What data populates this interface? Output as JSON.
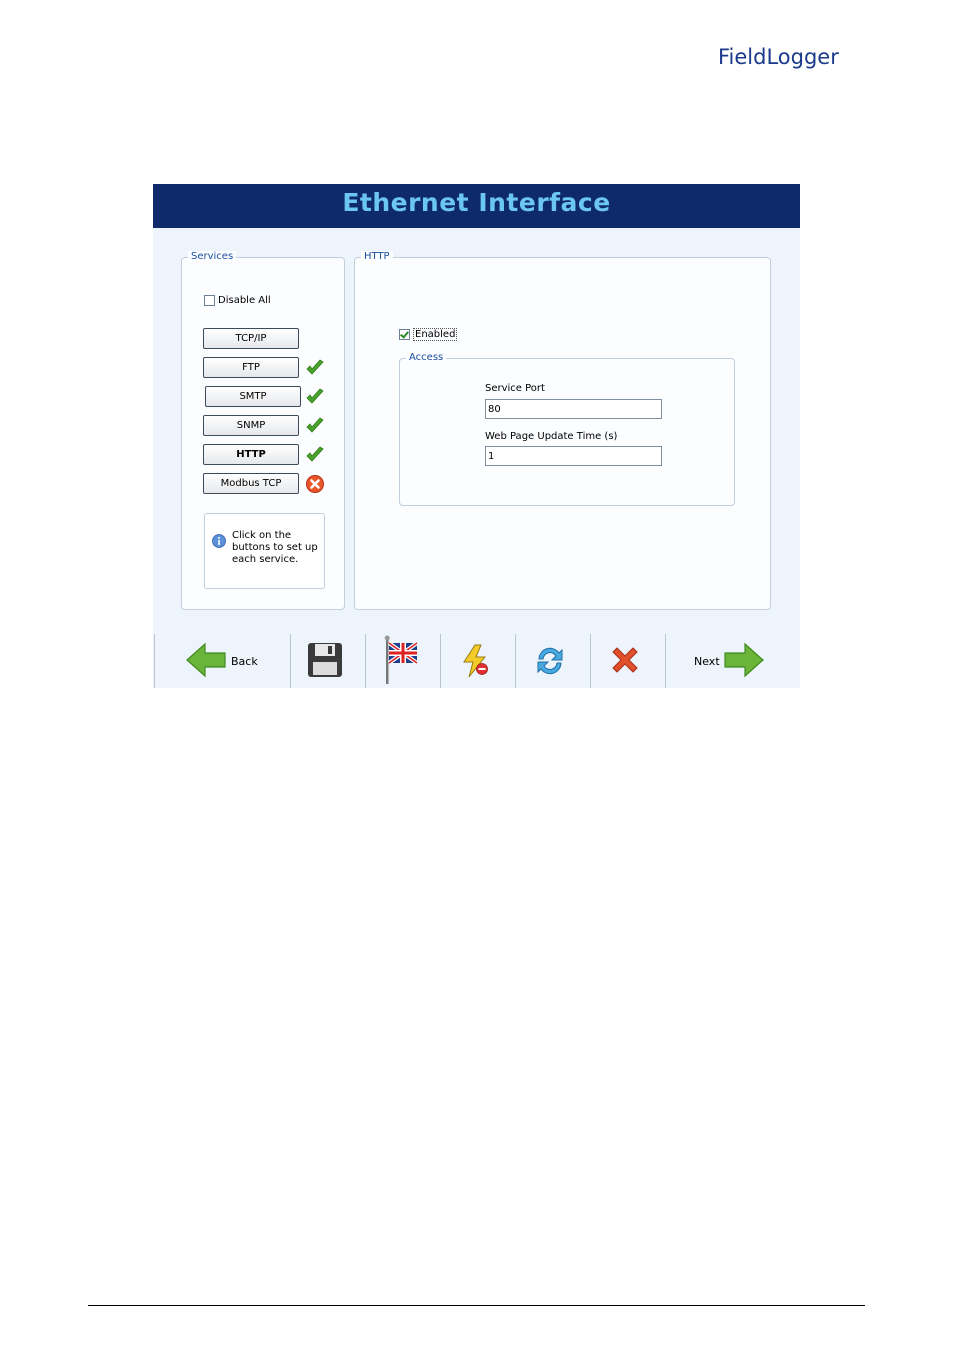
{
  "brand": {
    "logo_text": "FieldLogger",
    "color": "#1a3a8c"
  },
  "window": {
    "title": "Ethernet Interface",
    "title_color": "#6cc6f4",
    "bar_color": "#0f2a6b"
  },
  "services": {
    "group_label": "Services",
    "disable_all_label": "Disable All",
    "disable_all_checked": false,
    "items": [
      {
        "label": "TCP/IP",
        "status": "none"
      },
      {
        "label": "FTP",
        "status": "ok"
      },
      {
        "label": "SMTP",
        "status": "ok"
      },
      {
        "label": "SNMP",
        "status": "ok"
      },
      {
        "label": "HTTP",
        "status": "ok",
        "active": true
      },
      {
        "label": "Modbus TCP",
        "status": "error"
      }
    ],
    "info_text": "Click on the buttons to set up each service."
  },
  "http": {
    "group_label": "HTTP",
    "enabled_label": "Enabled",
    "enabled_checked": true,
    "access": {
      "group_label": "Access",
      "service_port_label": "Service Port",
      "service_port_value": "80",
      "update_time_label": "Web Page Update Time (s)",
      "update_time_value": "1"
    }
  },
  "toolbar": {
    "back_label": "Back",
    "next_label": "Next",
    "icons": [
      "back-arrow-icon",
      "save-icon",
      "language-flag-icon",
      "lightning-icon",
      "refresh-icon",
      "close-icon",
      "next-arrow-icon"
    ]
  }
}
